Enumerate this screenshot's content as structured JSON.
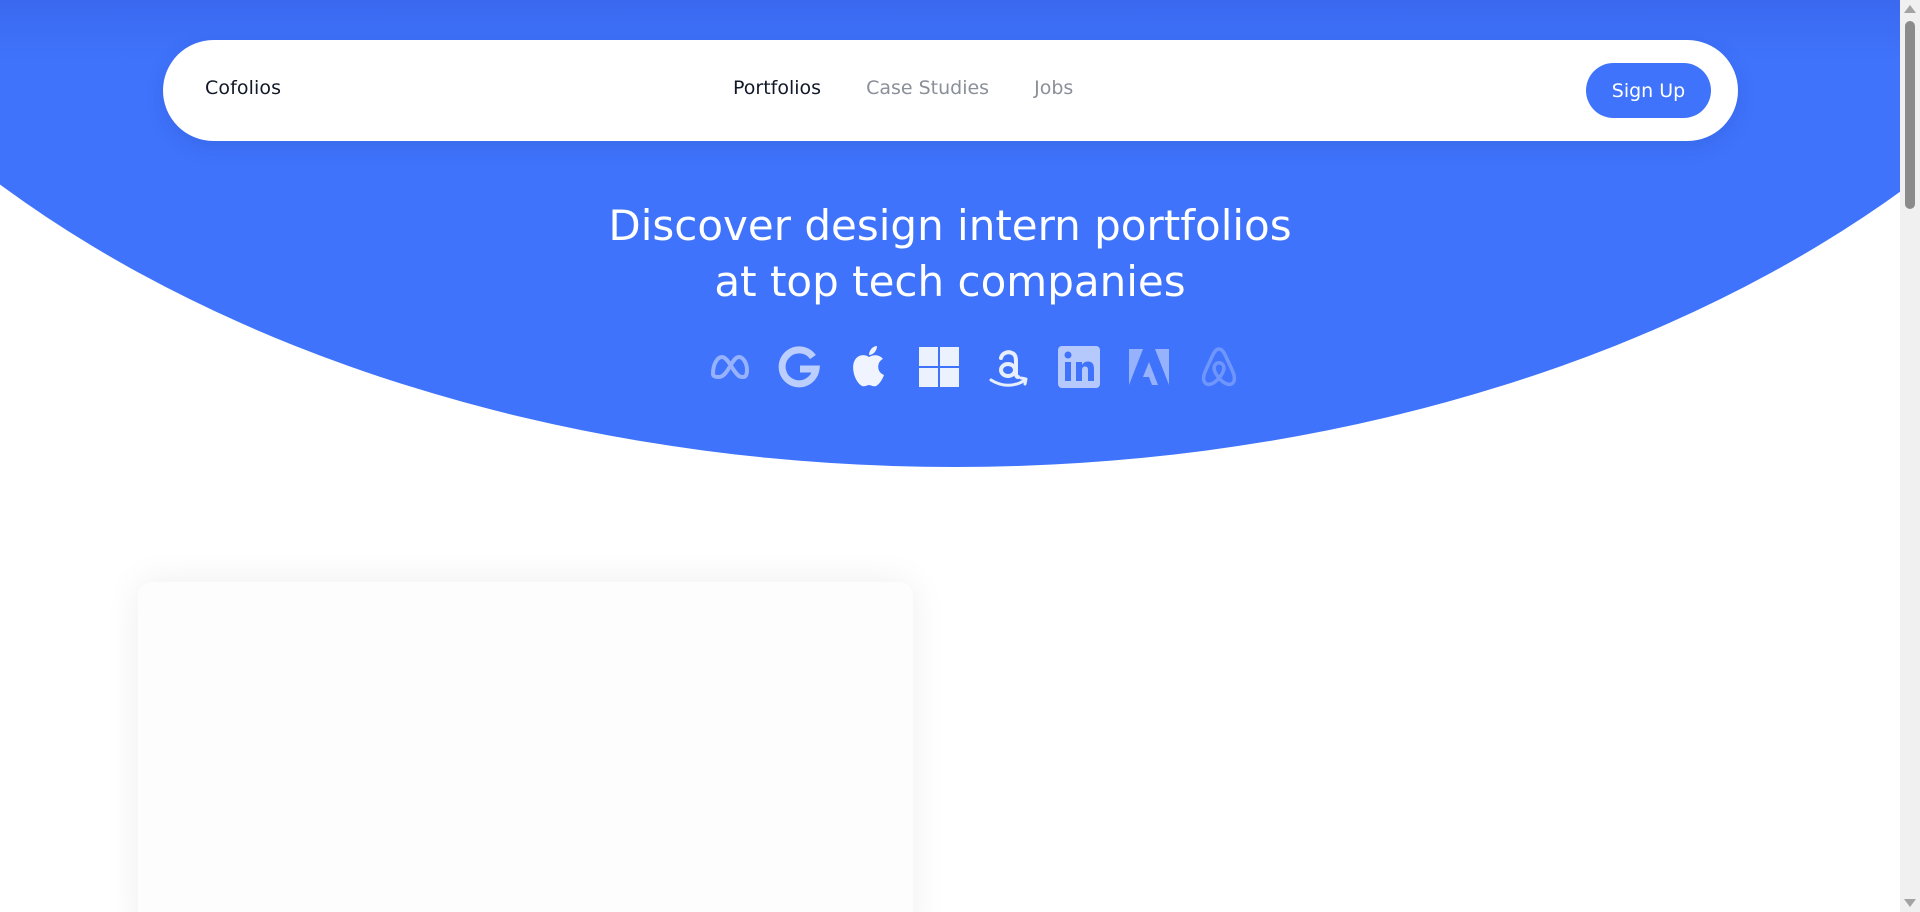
{
  "navbar": {
    "brand": "Cofolios",
    "links": [
      {
        "label": "Portfolios",
        "active": true
      },
      {
        "label": "Case Studies",
        "active": false
      },
      {
        "label": "Jobs",
        "active": false
      }
    ],
    "signup_label": "Sign Up"
  },
  "hero": {
    "headline_line1": "Discover design intern portfolios",
    "headline_line2": "at top tech companies",
    "logos": [
      "meta-icon",
      "google-icon",
      "apple-icon",
      "microsoft-icon",
      "amazon-icon",
      "linkedin-icon",
      "adobe-icon",
      "airbnb-icon"
    ]
  },
  "colors": {
    "accent": "#3f73fb",
    "nav_text_active": "#111827",
    "nav_text_inactive": "#8a8f98"
  }
}
